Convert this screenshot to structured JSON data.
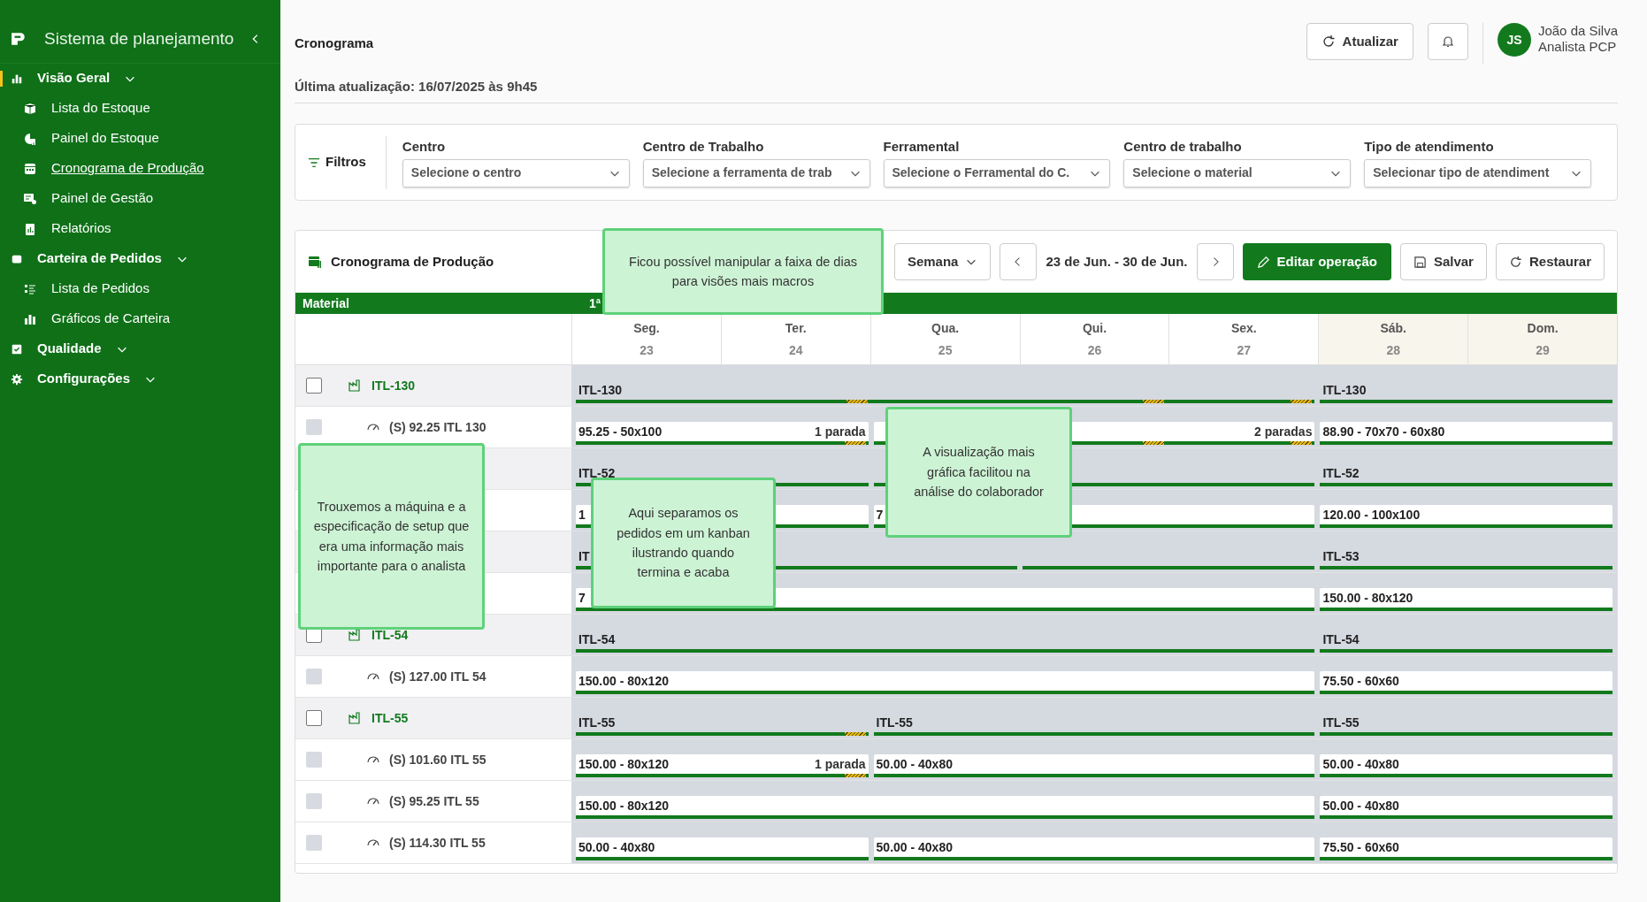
{
  "sidebar": {
    "title": "Sistema de planejamento",
    "sections": [
      {
        "label": "Visão Geral",
        "selected": true,
        "children": [
          {
            "label": "Lista do Estoque",
            "selected": false
          },
          {
            "label": "Painel do Estoque",
            "selected": false
          },
          {
            "label": "Cronograma de Produção",
            "selected": true
          },
          {
            "label": "Painel de Gestão",
            "selected": false
          },
          {
            "label": "Relatórios",
            "selected": false
          }
        ]
      },
      {
        "label": "Carteira de Pedidos",
        "selected": false,
        "children": [
          {
            "label": "Lista de Pedidos",
            "selected": false
          },
          {
            "label": "Gráficos de Carteira",
            "selected": false
          }
        ]
      },
      {
        "label": "Qualidade",
        "selected": false
      },
      {
        "label": "Configurações",
        "selected": false
      }
    ]
  },
  "header": {
    "title": "Cronograma",
    "updated": "Última atualização: 16/07/2025 às 9h45",
    "refresh_button": "Atualizar",
    "user": {
      "initials": "JS",
      "name": "João da Silva",
      "role": "Analista PCP"
    }
  },
  "filters": {
    "title": "Filtros",
    "fields": [
      {
        "label": "Centro",
        "placeholder": "Selecione o centro"
      },
      {
        "label": "Centro de Trabalho",
        "placeholder": "Selecione a ferramenta de trab"
      },
      {
        "label": "Ferramental",
        "placeholder": "Selecione o Ferramental do C."
      },
      {
        "label": "Centro de trabalho",
        "placeholder": "Selecione o material"
      },
      {
        "label": "Tipo de atendimento",
        "placeholder": "Selecionar tipo de atendiment"
      }
    ]
  },
  "schedule": {
    "title": "Cronograma de Produção",
    "range_select": "Semana",
    "date_range": "23 de Jun. - 30 de Jun.",
    "buttons": [
      {
        "label": "Editar operação",
        "kind": "primary"
      },
      {
        "label": "Salvar",
        "kind": "outline"
      },
      {
        "label": "Restaurar",
        "kind": "outline"
      }
    ],
    "columns": [
      "Material",
      "1ª"
    ],
    "days": [
      {
        "name": "Seg.",
        "date": "23",
        "weekend": false
      },
      {
        "name": "Ter.",
        "date": "24",
        "weekend": false
      },
      {
        "name": "Qua.",
        "date": "25",
        "weekend": false
      },
      {
        "name": "Qui.",
        "date": "26",
        "weekend": false
      },
      {
        "name": "Sex.",
        "date": "27",
        "weekend": false
      },
      {
        "name": "Sáb.",
        "date": "28",
        "weekend": true
      },
      {
        "name": "Dom.",
        "date": "29",
        "weekend": true
      }
    ],
    "rows": [
      {
        "kind": "group",
        "label": "ITL-130",
        "checked": false,
        "disabled": false,
        "bars": [
          {
            "label": "ITL-130",
            "kind": "long",
            "stop_days": [
              false,
              true,
              false,
              true,
              true
            ]
          },
          {
            "label": "ITL-130",
            "kind": "short"
          }
        ]
      },
      {
        "kind": "item",
        "label": "(S) 92.25 ITL 130",
        "checked": false,
        "disabled": true,
        "bars": [
          {
            "label": "95.25 - 50x100",
            "note": "1 parada",
            "kind": "short",
            "stop_days": [
              false,
              true
            ]
          },
          {
            "note": "2 paradas",
            "kind": "mid",
            "stop_days": [
              false,
              true,
              true
            ]
          },
          {
            "label": "88.90 - 70x70 - 60x80",
            "kind": "short"
          }
        ]
      },
      {
        "kind": "group",
        "bars": [
          {
            "label": "ITL-52",
            "kind": "short"
          },
          {
            "kind": "mid"
          },
          {
            "label": "ITL-52",
            "kind": "short"
          }
        ]
      },
      {
        "kind": "item",
        "bars": [
          {
            "label": "1",
            "kind": "short"
          },
          {
            "label": "7",
            "kind": "mid"
          },
          {
            "label": "120.00 - 100x100",
            "kind": "short"
          }
        ]
      },
      {
        "kind": "group",
        "bars": [
          {
            "label": "IT",
            "kind": "mid"
          },
          {
            "kind": "short"
          },
          {
            "label": "ITL-53",
            "kind": "short"
          }
        ]
      },
      {
        "kind": "item",
        "bars": [
          {
            "label": "7",
            "kind": "long"
          },
          {
            "label": "150.00 - 80x120",
            "kind": "short"
          }
        ]
      },
      {
        "kind": "group",
        "label": "ITL-54",
        "checked": false,
        "disabled": false,
        "bars": [
          {
            "label": "ITL-54",
            "kind": "long"
          },
          {
            "label": "ITL-54",
            "kind": "short"
          }
        ]
      },
      {
        "kind": "item",
        "label": "(S) 127.00 ITL 54",
        "checked": false,
        "disabled": true,
        "bars": [
          {
            "label": "150.00 - 80x120",
            "kind": "long"
          },
          {
            "label": "75.50 - 60x60",
            "kind": "short"
          }
        ]
      },
      {
        "kind": "group",
        "label": "ITL-55",
        "checked": false,
        "disabled": false,
        "bars": [
          {
            "label": "ITL-55",
            "kind": "short",
            "stop_days": [
              false,
              true
            ]
          },
          {
            "label": "ITL-55",
            "kind": "mid"
          },
          {
            "label": "ITL-55",
            "kind": "short"
          }
        ]
      },
      {
        "kind": "item",
        "label": "(S) 101.60 ITL 55",
        "checked": false,
        "disabled": true,
        "bars": [
          {
            "label": "150.00 - 80x120",
            "note": "1 parada",
            "kind": "short",
            "stop_days": [
              false,
              true
            ]
          },
          {
            "label": "50.00 - 40x80",
            "kind": "mid"
          },
          {
            "label": "50.00 - 40x80",
            "kind": "short"
          }
        ]
      },
      {
        "kind": "item",
        "label": "(S) 95.25 ITL 55",
        "checked": false,
        "disabled": true,
        "bars": [
          {
            "label": "150.00 - 80x120",
            "kind": "long"
          },
          {
            "label": "50.00 - 40x80",
            "kind": "short"
          }
        ]
      },
      {
        "kind": "item",
        "label": "(S) 114.30 ITL 55",
        "checked": false,
        "disabled": true,
        "bars": [
          {
            "label": "50.00 - 40x80",
            "kind": "short"
          },
          {
            "label": "50.00 - 40x80",
            "kind": "mid"
          },
          {
            "label": "75.50 - 60x60",
            "kind": "short"
          }
        ]
      }
    ]
  },
  "notes": [
    {
      "text": "Ficou possível manipular a faixa de dias para visões mais macros"
    },
    {
      "text": "Trouxemos a máquina e a especificação de setup que era uma informação mais importante para o analista"
    },
    {
      "text": "Aqui separamos os pedidos em um kanban ilustrando quando termina e acaba"
    },
    {
      "text": "A visualização mais gráfica facilitou na análise do colaborador"
    }
  ]
}
